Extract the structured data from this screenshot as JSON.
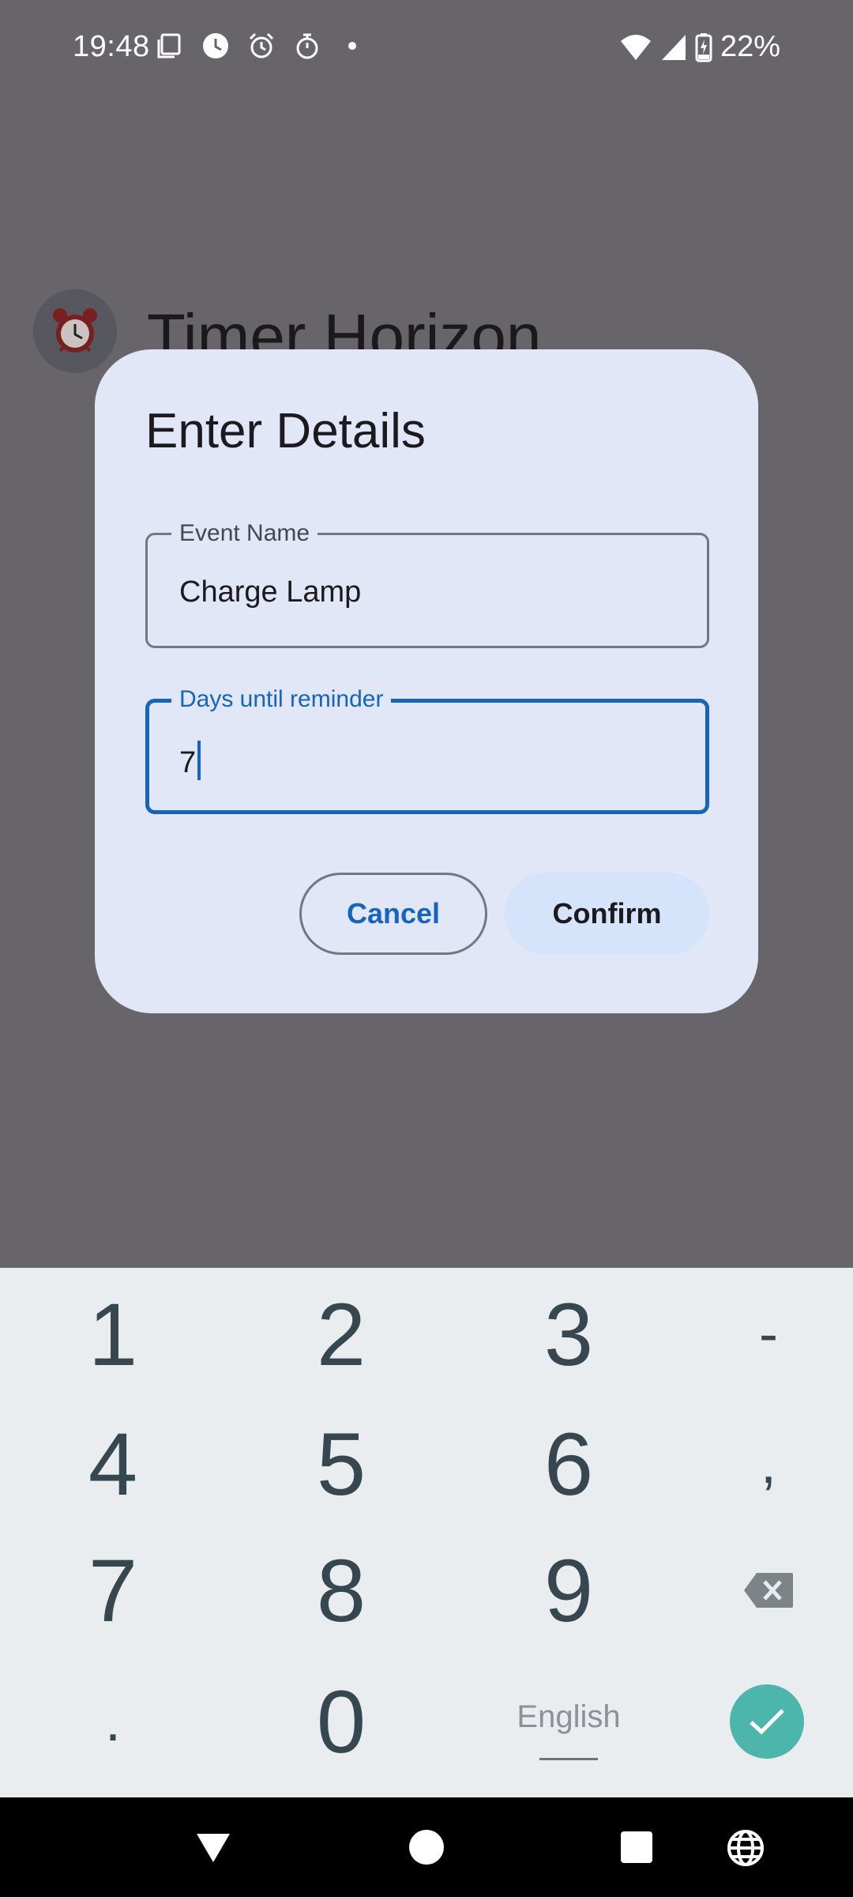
{
  "status_bar": {
    "time": "19:48",
    "battery_percent": "22%",
    "left_icons": [
      "screenshot-icon",
      "clock-icon",
      "alarm-icon",
      "stopwatch-icon",
      "dot-icon"
    ],
    "right_icons": [
      "wifi-icon",
      "signal-icon",
      "battery-charging-icon"
    ]
  },
  "app": {
    "title": "Timer Horizon",
    "avatar_icon": "alarm-clock-icon"
  },
  "dialog": {
    "title": "Enter Details",
    "event_name": {
      "label": "Event Name",
      "value": "Charge Lamp"
    },
    "days": {
      "label": "Days until reminder",
      "value": "7"
    },
    "cancel_label": "Cancel",
    "confirm_label": "Confirm"
  },
  "keyboard": {
    "row1": [
      "1",
      "2",
      "3",
      "-"
    ],
    "row2": [
      "4",
      "5",
      "6",
      ","
    ],
    "row3": [
      "7",
      "8",
      "9"
    ],
    "row4": [
      ".",
      "0"
    ],
    "language_label": "English",
    "backspace_icon": "backspace-icon",
    "enter_icon": "check-icon"
  },
  "colors": {
    "accent": "#1565c0",
    "dialog_bg": "#e1e7f6",
    "confirm_bg": "#d5e3fb",
    "enter_key": "#4db6ac",
    "scrim": "#676569"
  }
}
